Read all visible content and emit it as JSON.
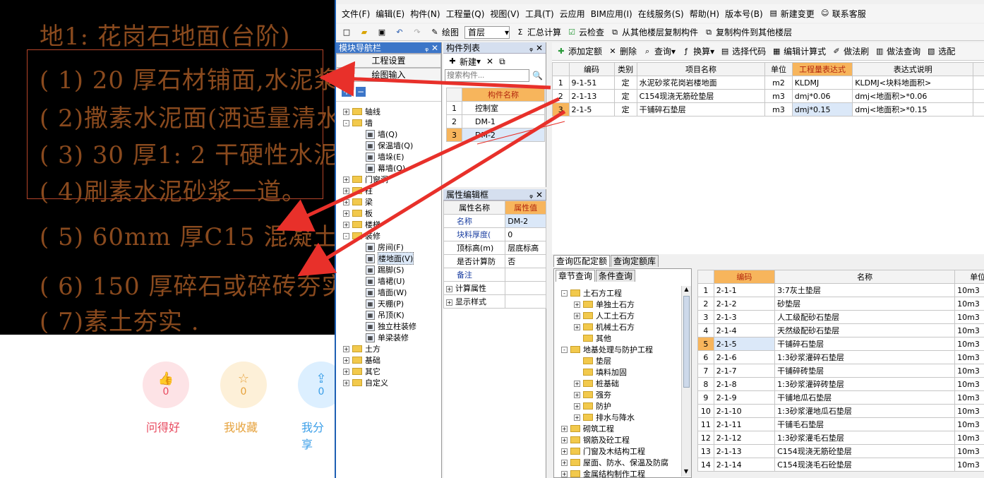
{
  "cad": {
    "lines": [
      "地1:  花岗石地面(台阶)",
      "( 1) 20  厚石材铺面,水泥浆擦缝",
      "( 2)撒素水泥面(洒适量清水)",
      "( 3) 30  厚1: 2 干硬性水泥砂浆",
      "( 4)刷素水泥砂浆一道。",
      "( 5) 60mm      厚C15   混凝土",
      "( 6) 150  厚碎石或碎砖夯实",
      "( 7)素土夯实   ."
    ]
  },
  "social": {
    "good": {
      "label": "问得好",
      "count": "0",
      "color": "#e84a5f"
    },
    "fav": {
      "label": "我收藏",
      "count": "0",
      "color": "#e6a23c"
    },
    "share": {
      "label": "我分享",
      "count": "0",
      "color": "#3a9ee8"
    }
  },
  "menu": [
    "文件(F)",
    "编辑(E)",
    "构件(N)",
    "工程量(Q)",
    "视图(V)",
    "工具(T)",
    "云应用",
    "BIM应用(I)",
    "在线服务(S)",
    "帮助(H)",
    "版本号(B)"
  ],
  "menu_buttons": {
    "new_change": "新建变更",
    "contact": "联系客服"
  },
  "toolbar": {
    "draw": "绘图",
    "floor": "首层",
    "sum": "汇总计算",
    "cloud_check": "云检查",
    "copy_from": "从其他楼层复制构件",
    "copy_to": "复制构件到其他楼层"
  },
  "nav": {
    "title": "模块导航栏",
    "project_settings": "工程设置",
    "draw_input": "绘图输入",
    "tree": [
      {
        "label": "轴线",
        "type": "folder",
        "exp": "+"
      },
      {
        "label": "墙",
        "type": "folder",
        "exp": "-"
      },
      {
        "label": "墙(Q)",
        "type": "leaf"
      },
      {
        "label": "保温墙(Q)",
        "type": "leaf"
      },
      {
        "label": "墙垛(E)",
        "type": "leaf"
      },
      {
        "label": "幕墙(Q)",
        "type": "leaf"
      },
      {
        "label": "门窗洞",
        "type": "folder",
        "exp": "+"
      },
      {
        "label": "柱",
        "type": "folder",
        "exp": "+"
      },
      {
        "label": "梁",
        "type": "folder",
        "exp": "+"
      },
      {
        "label": "板",
        "type": "folder",
        "exp": "+"
      },
      {
        "label": "楼梯",
        "type": "folder",
        "exp": "+"
      },
      {
        "label": "装修",
        "type": "folder",
        "exp": "-"
      },
      {
        "label": "房间(F)",
        "type": "leaf"
      },
      {
        "label": "楼地面(V)",
        "type": "leaf",
        "selected": true
      },
      {
        "label": "踢脚(S)",
        "type": "leaf"
      },
      {
        "label": "墙裙(U)",
        "type": "leaf"
      },
      {
        "label": "墙面(W)",
        "type": "leaf"
      },
      {
        "label": "天棚(P)",
        "type": "leaf"
      },
      {
        "label": "吊顶(K)",
        "type": "leaf"
      },
      {
        "label": "独立柱装修",
        "type": "leaf"
      },
      {
        "label": "单梁装修",
        "type": "leaf"
      },
      {
        "label": "土方",
        "type": "folder",
        "exp": "+"
      },
      {
        "label": "基础",
        "type": "folder",
        "exp": "+"
      },
      {
        "label": "其它",
        "type": "folder",
        "exp": "+"
      },
      {
        "label": "自定义",
        "type": "folder",
        "exp": "+"
      }
    ]
  },
  "complist": {
    "title": "构件列表",
    "new": "新建",
    "search_placeholder": "搜索构件...",
    "header": "构件名称",
    "rows": [
      {
        "n": "1",
        "name": "控制室"
      },
      {
        "n": "2",
        "name": "DM-1"
      },
      {
        "n": "3",
        "name": "DM-2"
      }
    ]
  },
  "props": {
    "title": "属性编辑框",
    "h_name": "属性名称",
    "h_val": "属性值",
    "rows": [
      {
        "name": "名称",
        "val": "DM-2",
        "blue": true
      },
      {
        "name": "块料厚度(",
        "val": "0",
        "blue": true
      },
      {
        "name": "顶标高(m)",
        "val": "层底标高",
        "blue": false
      },
      {
        "name": "是否计算防",
        "val": "否",
        "blue": false
      },
      {
        "name": "备注",
        "val": "",
        "blue": true
      },
      {
        "name": "计算属性",
        "val": "",
        "exp": "+"
      },
      {
        "name": "显示样式",
        "val": "",
        "exp": "+"
      }
    ]
  },
  "main_toolbar": {
    "add": "添加定额",
    "del": "删除",
    "query": "查询",
    "swap": "换算",
    "select_code": "选择代码",
    "edit_formula": "编辑计算式",
    "brush": "做法刷",
    "method_query": "做法查询",
    "select": "选配"
  },
  "main_table": {
    "headers": [
      "编码",
      "类别",
      "项目名称",
      "单位",
      "工程量表达式",
      "表达式说明",
      "单"
    ],
    "rows": [
      {
        "n": "1",
        "code": "9-1-51",
        "type": "定",
        "name": "水泥砂浆花岗岩楼地面",
        "unit": "m2",
        "expr": "KLDMJ",
        "desc": "KLDMJ<块料地面积>"
      },
      {
        "n": "2",
        "code": "2-1-13",
        "type": "定",
        "name": "C154现浇无筋砼垫层",
        "unit": "m3",
        "expr": "dmj*0.06",
        "desc": "dmj<地面积>*0.06"
      },
      {
        "n": "3",
        "code": "2-1-5",
        "type": "定",
        "name": "干铺碎石垫层",
        "unit": "m3",
        "expr": "dmj*0.15",
        "desc": "dmj<地面积>*0.15"
      }
    ]
  },
  "lower_tabs": [
    "查询匹配定额",
    "查询定额库"
  ],
  "lower_subtabs": [
    "章节查询",
    "条件查询"
  ],
  "chapter_tree": [
    {
      "label": "土石方工程",
      "exp": "-",
      "lvl": 0
    },
    {
      "label": "单独土石方",
      "exp": "+",
      "lvl": 1
    },
    {
      "label": "人工土石方",
      "exp": "+",
      "lvl": 1
    },
    {
      "label": "机械土石方",
      "exp": "+",
      "lvl": 1
    },
    {
      "label": "其他",
      "exp": "",
      "lvl": 1
    },
    {
      "label": "地基处理与防护工程",
      "exp": "-",
      "lvl": 0
    },
    {
      "label": "垫层",
      "exp": "",
      "lvl": 1
    },
    {
      "label": "填料加固",
      "exp": "",
      "lvl": 1
    },
    {
      "label": "桩基础",
      "exp": "+",
      "lvl": 1
    },
    {
      "label": "强夯",
      "exp": "+",
      "lvl": 1
    },
    {
      "label": "防护",
      "exp": "+",
      "lvl": 1
    },
    {
      "label": "排水与降水",
      "exp": "+",
      "lvl": 1
    },
    {
      "label": "砌筑工程",
      "exp": "+",
      "lvl": 0
    },
    {
      "label": "钢筋及砼工程",
      "exp": "+",
      "lvl": 0
    },
    {
      "label": "门窗及木结构工程",
      "exp": "+",
      "lvl": 0
    },
    {
      "label": "屋面、防水、保温及防腐",
      "exp": "+",
      "lvl": 0
    },
    {
      "label": "金属结构制作工程",
      "exp": "+",
      "lvl": 0
    }
  ],
  "quota_table": {
    "headers": [
      "编码",
      "名称",
      "单位"
    ],
    "rows": [
      {
        "n": "1",
        "code": "2-1-1",
        "name": "3:7灰土垫层",
        "unit": "10m3"
      },
      {
        "n": "2",
        "code": "2-1-2",
        "name": "砂垫层",
        "unit": "10m3"
      },
      {
        "n": "3",
        "code": "2-1-3",
        "name": "人工级配砂石垫层",
        "unit": "10m3"
      },
      {
        "n": "4",
        "code": "2-1-4",
        "name": "天然级配砂石垫层",
        "unit": "10m3"
      },
      {
        "n": "5",
        "code": "2-1-5",
        "name": "干铺碎石垫层",
        "unit": "10m3",
        "sel": true
      },
      {
        "n": "6",
        "code": "2-1-6",
        "name": "1:3砂浆灌碎石垫层",
        "unit": "10m3"
      },
      {
        "n": "7",
        "code": "2-1-7",
        "name": "干铺碎砖垫层",
        "unit": "10m3"
      },
      {
        "n": "8",
        "code": "2-1-8",
        "name": "1:3砂浆灌碎砖垫层",
        "unit": "10m3"
      },
      {
        "n": "9",
        "code": "2-1-9",
        "name": "干铺地瓜石垫层",
        "unit": "10m3"
      },
      {
        "n": "10",
        "code": "2-1-10",
        "name": "1:3砂浆灌地瓜石垫层",
        "unit": "10m3"
      },
      {
        "n": "11",
        "code": "2-1-11",
        "name": "干铺毛石垫层",
        "unit": "10m3"
      },
      {
        "n": "12",
        "code": "2-1-12",
        "name": "1:3砂浆灌毛石垫层",
        "unit": "10m3"
      },
      {
        "n": "13",
        "code": "2-1-13",
        "name": "C154现浇无筋砼垫层",
        "unit": "10m3"
      },
      {
        "n": "14",
        "code": "2-1-14",
        "name": "C154现浇毛石砼垫层",
        "unit": "10m3"
      }
    ]
  },
  "colors": {
    "accent": "#f7b55c",
    "arrow": "#e8302a",
    "cad_text": "#8a4a1e",
    "nav_title": "#3c76c8"
  }
}
